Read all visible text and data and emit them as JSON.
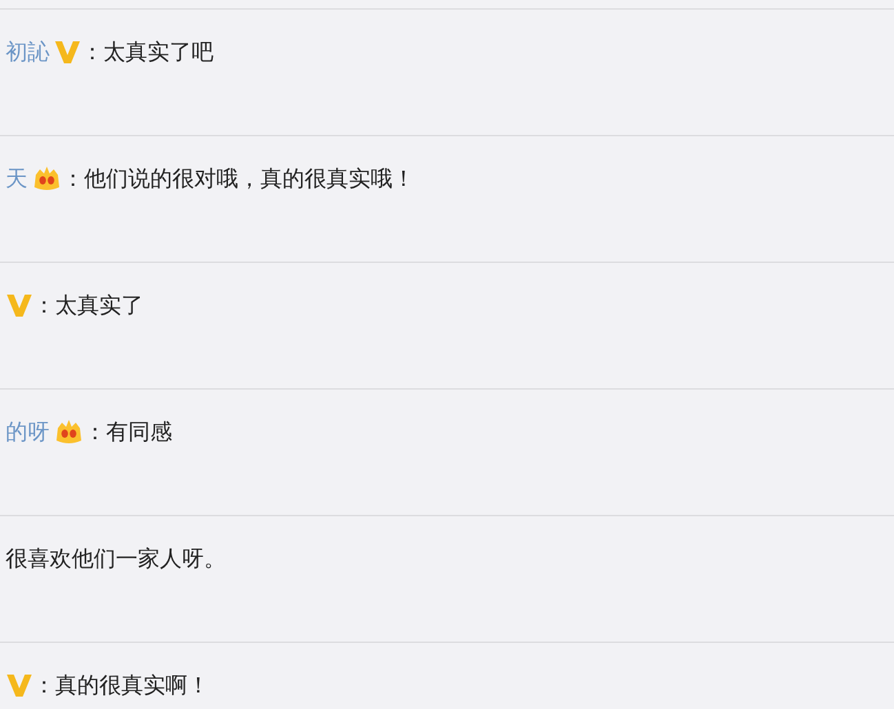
{
  "comments": [
    {
      "name": "初訫",
      "kind": "v",
      "text": "：太真实了吧"
    },
    {
      "name": "天",
      "kind": "crown",
      "text": "：他们说的很对哦，真的很真实哦！"
    },
    {
      "kind": "v",
      "text": "：太真实了"
    },
    {
      "name": "的呀",
      "kind": "crown",
      "text": "：有同感"
    },
    {
      "kind": "plain",
      "text": "很喜欢他们一家人呀。"
    },
    {
      "kind": "v",
      "text": "：真的很真实啊！"
    }
  ]
}
